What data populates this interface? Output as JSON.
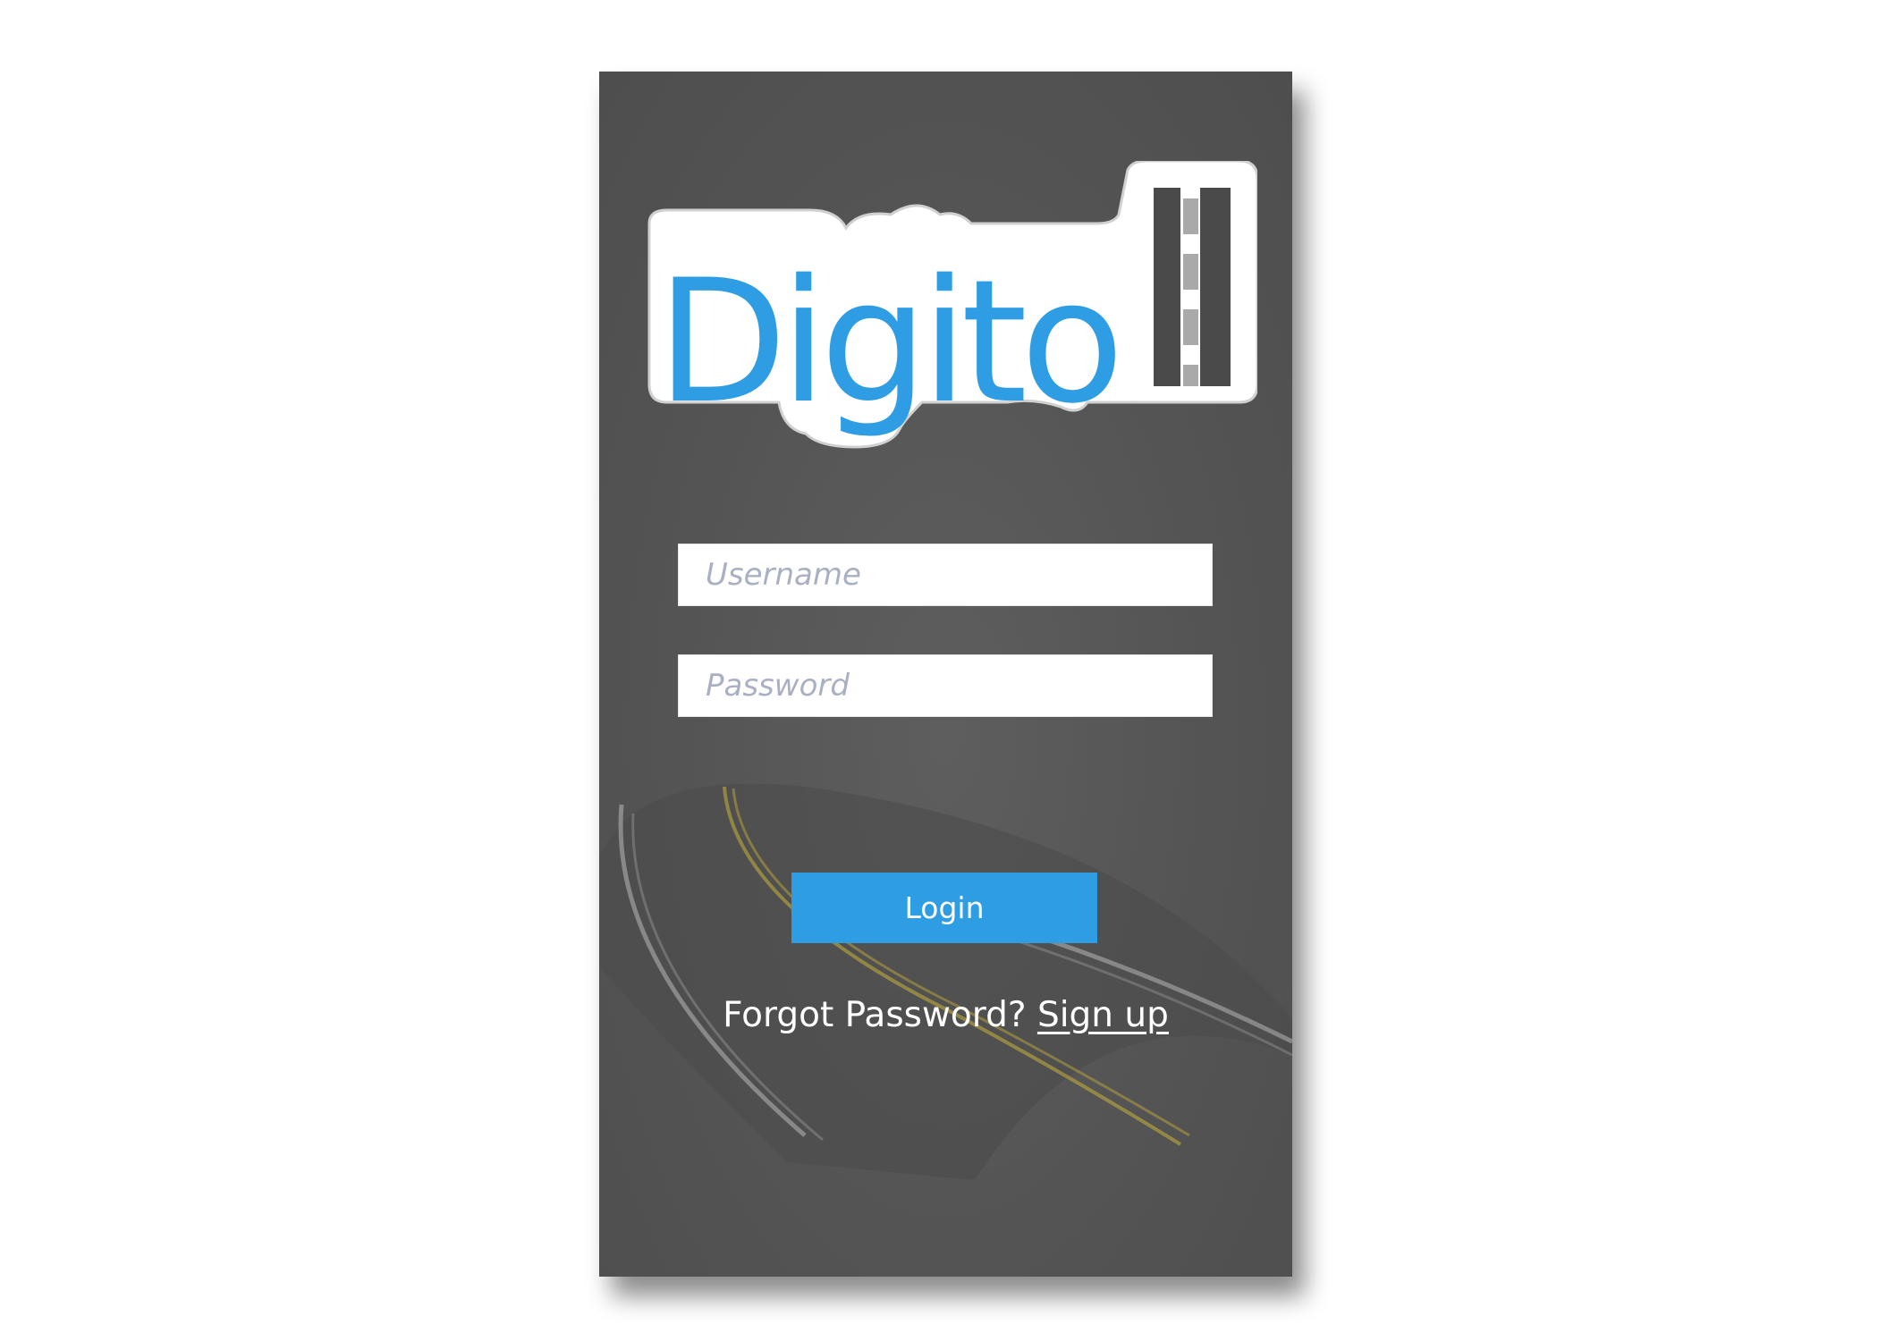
{
  "brand": {
    "logo_text": "Digito",
    "accent_color": "#2e9de4",
    "panel_color": "#545454"
  },
  "login_form": {
    "username_placeholder": "Username",
    "username_value": "",
    "password_placeholder": "Password",
    "password_value": "",
    "login_label": "Login"
  },
  "links": {
    "forgot_label": "Forgot Password?",
    "signup_label": "Sign up"
  }
}
